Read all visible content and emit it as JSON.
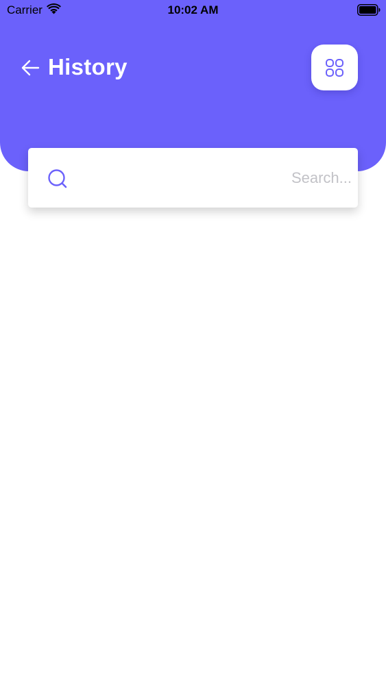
{
  "status_bar": {
    "carrier": "Carrier",
    "time": "10:02 AM"
  },
  "header": {
    "title": "History",
    "back_icon": "arrow-left-icon",
    "menu_icon": "grid-icon"
  },
  "search": {
    "placeholder": "Search...",
    "value": "",
    "icon": "search-icon"
  },
  "colors": {
    "accent": "#6b61fb",
    "background": "#ffffff",
    "placeholder": "#c2c2c7"
  }
}
